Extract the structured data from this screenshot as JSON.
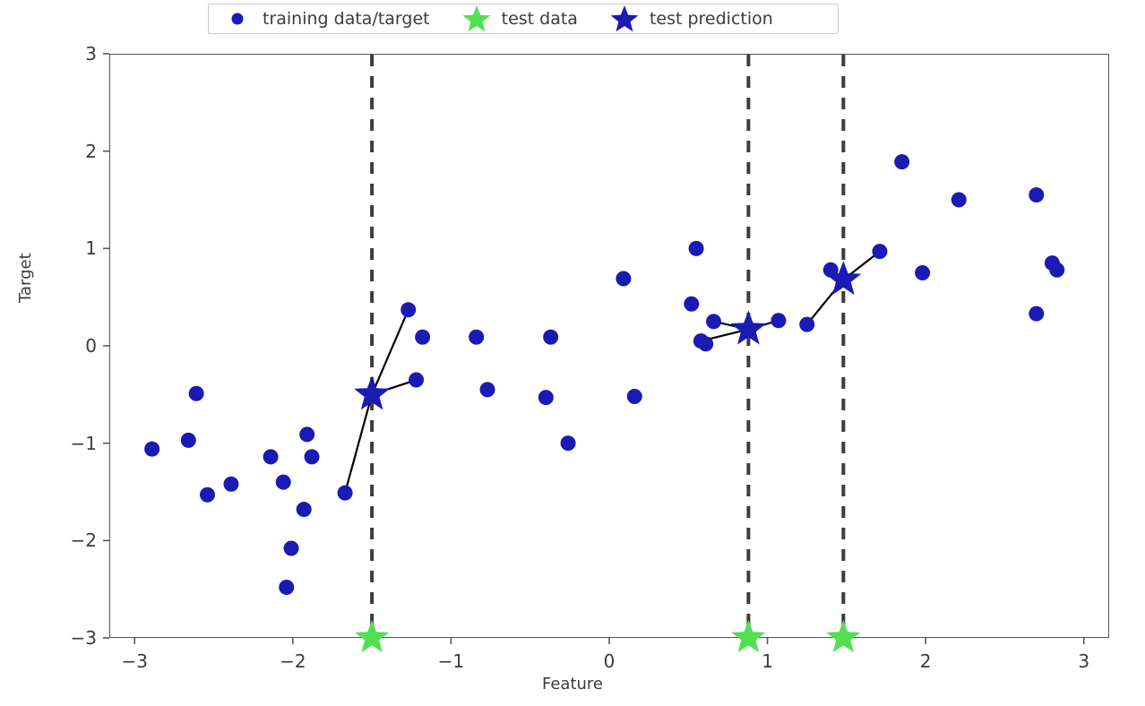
{
  "legend": {
    "entries": [
      {
        "label": "training data/target",
        "marker": "circle-marker",
        "color": "#1a1ab4"
      },
      {
        "label": "test data",
        "marker": "star-marker",
        "color": "#52e052"
      },
      {
        "label": "test prediction",
        "marker": "star-marker",
        "color": "#1a1ab4"
      }
    ]
  },
  "chart_data": {
    "type": "scatter",
    "title": "",
    "xlabel": "Feature",
    "ylabel": "Target",
    "xlim": [
      -3.16,
      3.16
    ],
    "ylim": [
      -3.0,
      3.0
    ],
    "xticks": [
      -3,
      -2,
      -1,
      0,
      1,
      2,
      3
    ],
    "xtick_labels": [
      "−3",
      "−2",
      "−1",
      "0",
      "1",
      "2",
      "3"
    ],
    "yticks": [
      -3,
      -2,
      -1,
      0,
      1,
      2,
      3
    ],
    "ytick_labels": [
      "−3",
      "−2",
      "−1",
      "0",
      "1",
      "2",
      "3"
    ],
    "grid": false,
    "legend_position": "upper center",
    "series": [
      {
        "name": "training data/target",
        "marker": "circle",
        "color": "#1a1ab4",
        "points": [
          [
            -2.89,
            -1.06
          ],
          [
            -2.66,
            -0.97
          ],
          [
            -2.61,
            -0.49
          ],
          [
            -2.54,
            -1.53
          ],
          [
            -2.39,
            -1.42
          ],
          [
            -2.14,
            -1.14
          ],
          [
            -2.06,
            -1.4
          ],
          [
            -2.04,
            -2.48
          ],
          [
            -2.01,
            -2.08
          ],
          [
            -1.93,
            -1.68
          ],
          [
            -1.91,
            -0.91
          ],
          [
            -1.88,
            -1.14
          ],
          [
            -1.67,
            -1.51
          ],
          [
            -1.27,
            0.37
          ],
          [
            -1.22,
            -0.35
          ],
          [
            -1.18,
            0.09
          ],
          [
            -0.84,
            0.09
          ],
          [
            -0.77,
            -0.45
          ],
          [
            -0.4,
            -0.53
          ],
          [
            -0.37,
            0.09
          ],
          [
            -0.26,
            -1.0
          ],
          [
            0.09,
            0.69
          ],
          [
            0.16,
            -0.52
          ],
          [
            0.55,
            1.0
          ],
          [
            0.52,
            0.43
          ],
          [
            0.58,
            0.05
          ],
          [
            0.61,
            0.02
          ],
          [
            0.66,
            0.25
          ],
          [
            1.07,
            0.26
          ],
          [
            1.25,
            0.22
          ],
          [
            1.4,
            0.78
          ],
          [
            1.71,
            0.97
          ],
          [
            1.85,
            1.89
          ],
          [
            1.98,
            0.75
          ],
          [
            2.21,
            1.5
          ],
          [
            2.7,
            1.55
          ],
          [
            2.7,
            0.33
          ],
          [
            2.8,
            0.85
          ],
          [
            2.83,
            0.78
          ]
        ]
      },
      {
        "name": "test data",
        "marker": "star",
        "color": "#52e052",
        "points": [
          [
            -1.5,
            -3.0
          ],
          [
            0.88,
            -3.0
          ],
          [
            1.48,
            -3.0
          ]
        ]
      },
      {
        "name": "test prediction",
        "marker": "star",
        "color": "#1a1ab4",
        "points": [
          [
            -1.5,
            -0.5
          ],
          [
            0.88,
            0.17
          ],
          [
            1.48,
            0.68
          ]
        ]
      }
    ],
    "vertical_lines": {
      "x": [
        -1.5,
        0.88,
        1.48
      ],
      "style": "dashed",
      "color": "#3c3c3c"
    },
    "neighbor_links": {
      "color": "#000000",
      "links": [
        [
          [
            -1.5,
            -0.5
          ],
          [
            -1.67,
            -1.51
          ]
        ],
        [
          [
            -1.5,
            -0.5
          ],
          [
            -1.27,
            0.37
          ]
        ],
        [
          [
            -1.5,
            -0.5
          ],
          [
            -1.22,
            -0.35
          ]
        ],
        [
          [
            0.88,
            0.17
          ],
          [
            0.66,
            0.25
          ]
        ],
        [
          [
            0.88,
            0.17
          ],
          [
            0.58,
            0.05
          ]
        ],
        [
          [
            0.88,
            0.17
          ],
          [
            1.07,
            0.26
          ]
        ],
        [
          [
            1.48,
            0.68
          ],
          [
            1.25,
            0.22
          ]
        ],
        [
          [
            1.48,
            0.68
          ],
          [
            1.4,
            0.78
          ]
        ],
        [
          [
            1.48,
            0.68
          ],
          [
            1.71,
            0.97
          ]
        ]
      ]
    }
  }
}
